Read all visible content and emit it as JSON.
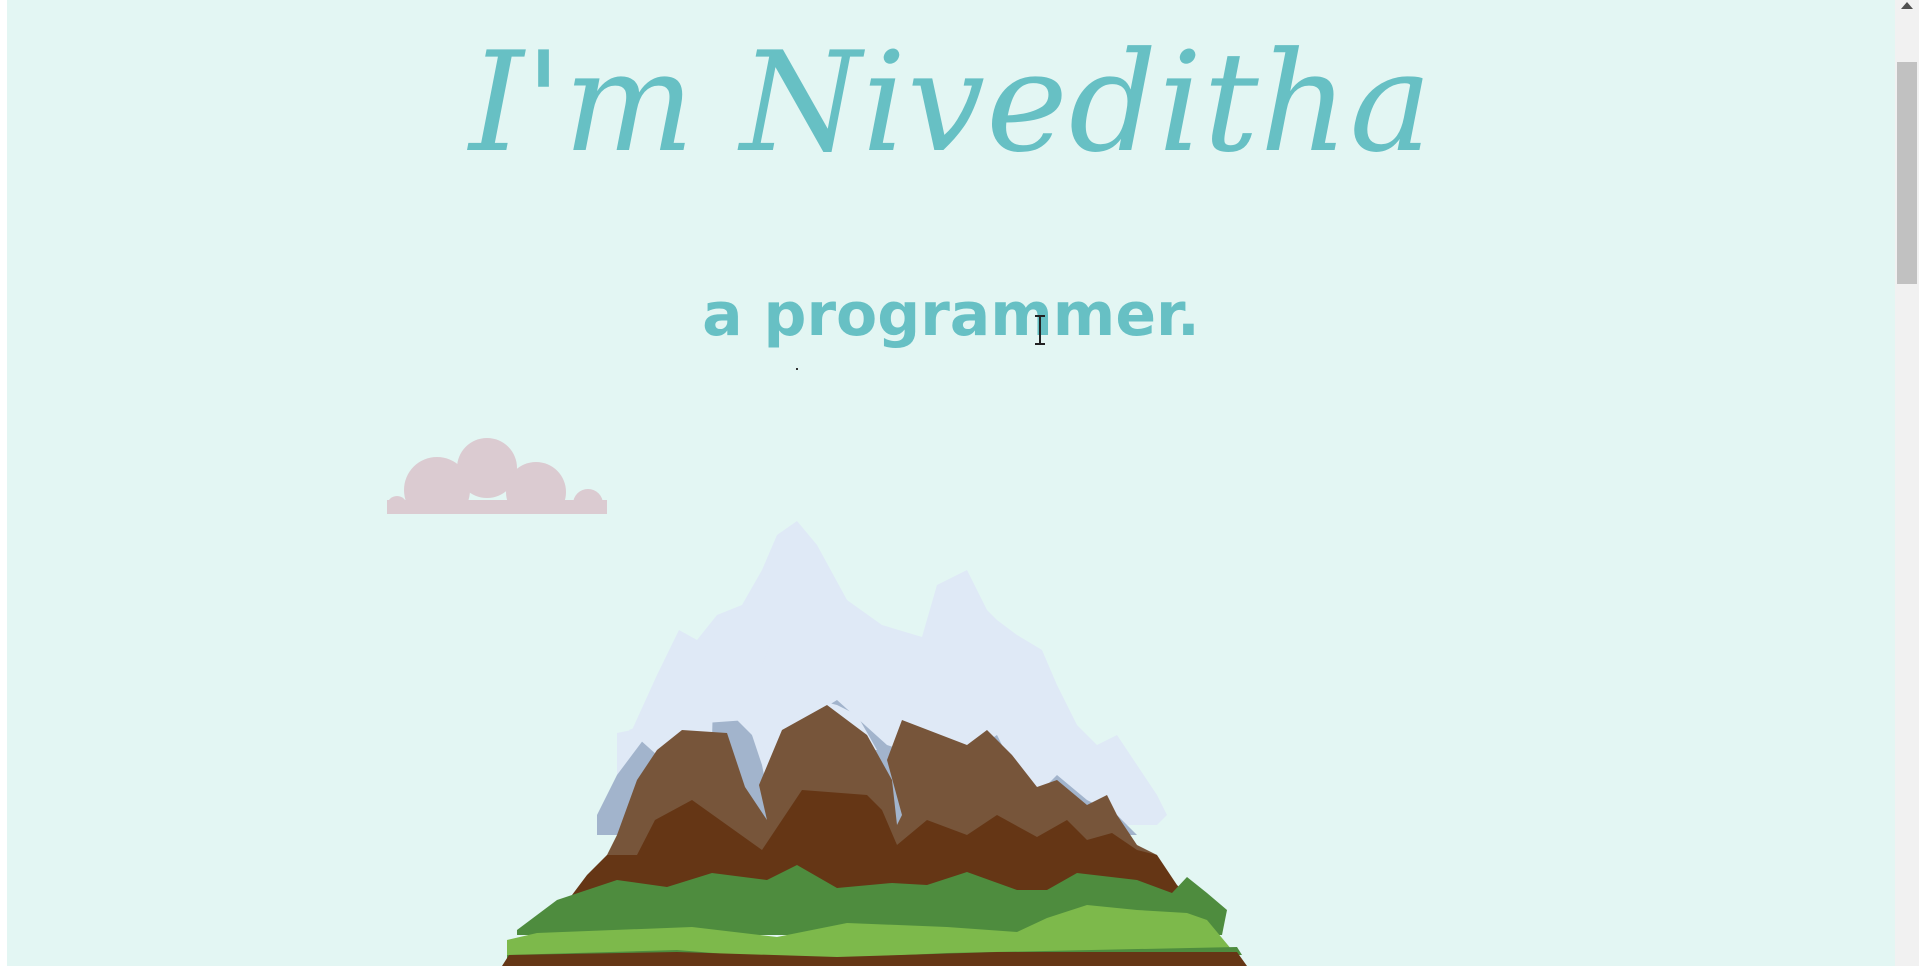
{
  "hero": {
    "title": "I'm Niveditha",
    "subtitle": "a programmer."
  },
  "icons": {
    "cursor": "text-cursor-icon",
    "cloud": "cloud-illustration",
    "mountain": "mountain-illustration",
    "scroll_up": "chevron-up-icon"
  },
  "colors": {
    "background": "#e3f6f3",
    "accent": "#67c0c4",
    "cloud": "#dbcbd1",
    "snow": "#dfe9f6",
    "snow_shadow": "#a2b4cc",
    "rock": "#77553a",
    "rock_dark": "#653615",
    "grass": "#4e8c3e",
    "grass_light": "#7db94b"
  },
  "scrollbar": {
    "scroll_position": 0.0
  }
}
